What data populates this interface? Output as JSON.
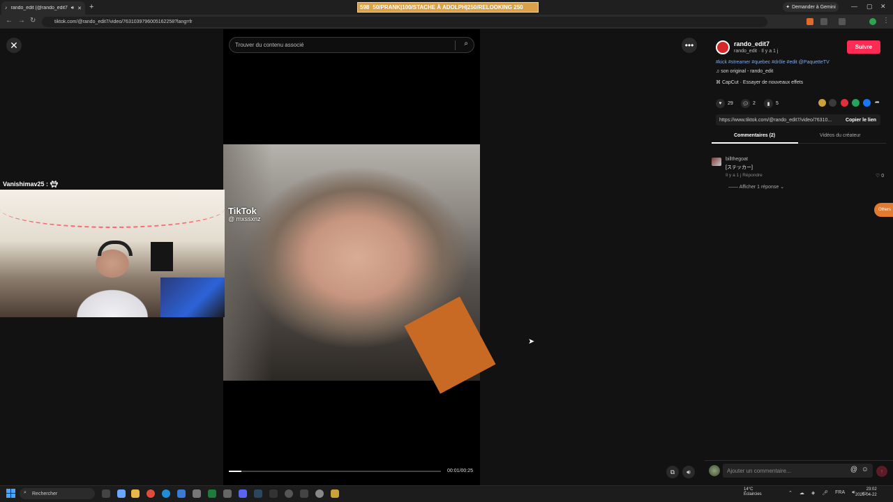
{
  "browser": {
    "tab_title": "rando_edit (@rando_edit7)",
    "url": "tiktok.com/@rando_edit7/video/7631039796005162258?lang=fr",
    "gemini_label": "Demander à Gemini"
  },
  "stream_banner": {
    "count": "598",
    "text": "50/PRANK|100/STACHE À ADOLPH|250/RELOOKING 250"
  },
  "video": {
    "search_placeholder": "Trouver du contenu associé",
    "watermark_brand": "TikTok",
    "watermark_handle": "@ mxssxnz",
    "time": "00:01/00:25",
    "progress": 0.06
  },
  "webcam": {
    "label": "Vanishimav25 :"
  },
  "creator": {
    "username": "rando_edit7",
    "subtitle": "rando_edit · Il y a 1 j",
    "follow_label": "Suivre",
    "hashtags": "#kick #streamer #quebec #drôle #edit @PaquetteTV",
    "sound": "son original - rando_edit",
    "capcut": "CapCut · Essayer de nouveaux effets"
  },
  "stats": {
    "likes": "29",
    "comments": "2",
    "saves": "5"
  },
  "share": {
    "link": "https://www.tiktok.com/@rando_edit7/video/76310...",
    "copy_label": "Copier le lien",
    "colors": [
      "#c9a23a",
      "#3a3a3a",
      "#e0303c",
      "#25a35a",
      "#1877f2"
    ]
  },
  "comment_tabs": [
    "Commentaires (2)",
    "Vidéos du créateur"
  ],
  "comment": {
    "user": "billthegoat",
    "text": "[ステッカー]",
    "meta": "Il y a 1 j   Répondre",
    "likes": "0",
    "replies": "Afficher 1 réponse"
  },
  "others_label": "Others",
  "comment_input_placeholder": "Ajouter un commentaire...",
  "taskbar": {
    "search_label": "Rechercher",
    "weather_temp": "14°C",
    "weather_desc": "Éclaircies",
    "lang": "FRA",
    "time": "23:02",
    "date": "2026-04-22"
  }
}
